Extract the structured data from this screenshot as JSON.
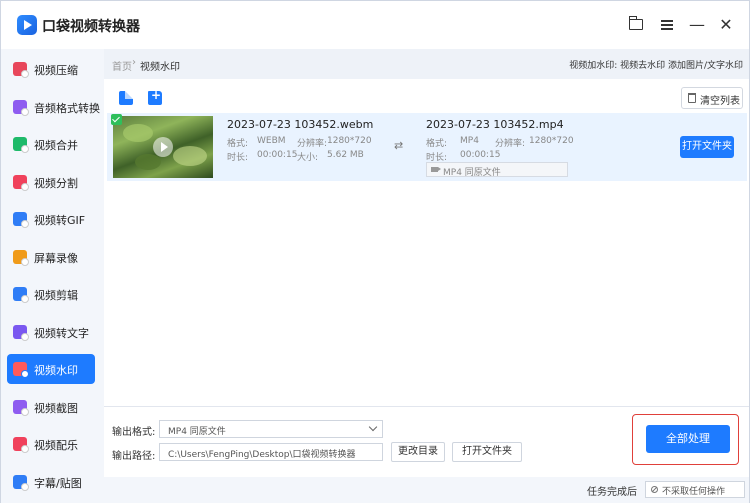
{
  "app": {
    "title": "口袋视频转换器"
  },
  "window_controls": [
    {
      "name": "folder-icon"
    },
    {
      "name": "menu-icon"
    },
    {
      "name": "minimize-icon",
      "glyph": "—"
    },
    {
      "name": "close-icon",
      "glyph": "✕"
    }
  ],
  "sidebar": {
    "items": [
      {
        "label": "视频压缩",
        "icon_color": "#e8475b",
        "active": false
      },
      {
        "label": "音频格式转换",
        "icon_color": "#8e5cf0",
        "active": false
      },
      {
        "label": "视频合并",
        "icon_color": "#1fba6a",
        "active": false
      },
      {
        "label": "视频分割",
        "icon_color": "#f0425c",
        "active": false
      },
      {
        "label": "视频转GIF",
        "icon_color": "#2f7df6",
        "active": false
      },
      {
        "label": "屏幕录像",
        "icon_color": "#f09b1a",
        "active": false
      },
      {
        "label": "视频剪辑",
        "icon_color": "#2f7df6",
        "active": false
      },
      {
        "label": "视频转文字",
        "icon_color": "#7a58f0",
        "active": false
      },
      {
        "label": "视频水印",
        "icon_color": "#ff5a5a",
        "active": true
      },
      {
        "label": "视频截图",
        "icon_color": "#8e5cf0",
        "active": false
      },
      {
        "label": "视频配乐",
        "icon_color": "#f0425c",
        "active": false
      },
      {
        "label": "字幕/贴图",
        "icon_color": "#2f7df6",
        "active": false
      }
    ]
  },
  "breadcrumb": {
    "home": "首页",
    "separator": "›",
    "current": "视频水印",
    "right_text": "视频加水印: 视频去水印 添加图片/文字水印"
  },
  "toolbar": {
    "add_file_icon": "add-file-icon",
    "add_folder_icon": "add-folder-icon",
    "clear_label": "清空列表"
  },
  "file": {
    "input_name": "2023-07-23 103452.webm",
    "input_format_label": "格式:",
    "input_format": "WEBM",
    "input_res_label": "分辨率:",
    "input_res": "1280*720",
    "input_duration_label": "时长:",
    "input_duration": "00:00:15",
    "input_size_label": "大小:",
    "input_size": "5.62 MB",
    "output_name": "2023-07-23 103452.mp4",
    "output_format_label": "格式:",
    "output_format": "MP4",
    "output_res_label": "分辨率:",
    "output_res": "1280*720",
    "output_duration_label": "时长:",
    "output_duration": "00:00:15",
    "output_select": "MP4  同原文件",
    "open_folder_label": "打开文件夹"
  },
  "settings": {
    "format_label": "输出格式:",
    "format_value": "MP4  同原文件",
    "path_label": "输出路径:",
    "path_value": "C:\\Users\\FengPing\\Desktop\\口袋视频转换器",
    "change_dir_label": "更改目录",
    "open_folder_label": "打开文件夹",
    "process_all_label": "全部处理"
  },
  "status": {
    "after_label": "任务完成后",
    "after_value": "不采取任何操作"
  }
}
